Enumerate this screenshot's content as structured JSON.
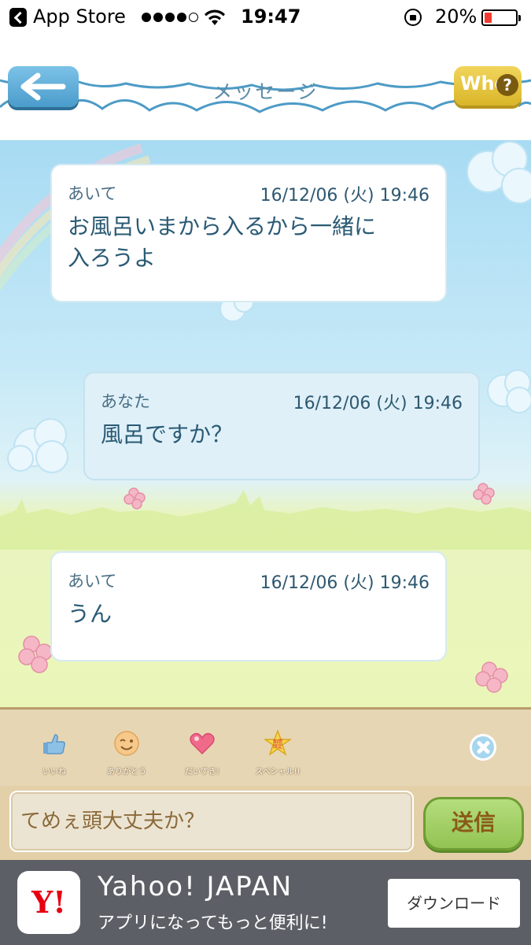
{
  "status_bar": {
    "app_back_label": "App Store",
    "time": "19:47",
    "battery_percent": "20%",
    "signal_bars": 4,
    "signal_max": 5
  },
  "header": {
    "title": "メッセージ",
    "who_label": "Who",
    "who_icon": "?"
  },
  "messages": [
    {
      "sender": "あいて",
      "timestamp": "16/12/06 (火) 19:46",
      "text": "お風呂いまから入るから一緒に\n入ろうよ"
    },
    {
      "sender": "あなた",
      "timestamp": "16/12/06 (火) 19:46",
      "text": "風呂ですか？"
    },
    {
      "sender": "あいて",
      "timestamp": "16/12/06 (火) 19:46",
      "text": "うん"
    }
  ],
  "reactions": [
    {
      "label": "いいね",
      "icon": "thumbs-up-icon"
    },
    {
      "label": "ありがとう",
      "icon": "wink-face-icon"
    },
    {
      "label": "だいすき!",
      "icon": "heart-icon"
    },
    {
      "label": "スペシャル!!",
      "icon": "star-icon",
      "badge": "期間\n限定"
    }
  ],
  "input": {
    "value": "てめぇ頭大丈夫か？",
    "send_label": "送信"
  },
  "ad": {
    "logo": "Y!",
    "title": "Yahoo! JAPAN",
    "subtitle": "アプリになってもっと便利に!",
    "button": "ダウンロード"
  },
  "colors": {
    "sky": "#a7dbf3",
    "back_button": "#4a9ccb",
    "who_button": "#d9b62a",
    "send_button": "#92c352",
    "yahoo_red": "#e60012"
  }
}
